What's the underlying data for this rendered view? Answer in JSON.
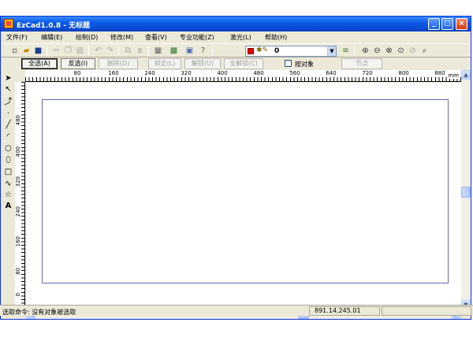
{
  "window": {
    "title": "EzCad1.0.8 - 无标题",
    "controls": {
      "minimize": "_",
      "maximize": "□",
      "close": "×"
    }
  },
  "menubar": {
    "items": [
      "文件(F)",
      "编辑(E)",
      "绘制(D)",
      "修改(M)",
      "查看(V)",
      "专业功能(Z)",
      "激光(L)",
      "帮助(H)"
    ]
  },
  "toolbar": {
    "icons": [
      "new-icon",
      "open-icon",
      "save-icon",
      "cut-icon",
      "copy-icon",
      "paste-icon",
      "undo-icon",
      "redo-icon",
      "group-icon",
      "ungroup-icon",
      "grid-icon",
      "bitmap-icon",
      "export-icon",
      "help-icon",
      "zoom-in-icon",
      "zoom-out-icon",
      "zoom-fit-icon",
      "zoom-all-icon",
      "zoom-prev-icon",
      "zoom-window-icon"
    ],
    "layer_value": "0",
    "layer_color": "#e00000"
  },
  "selectbar": {
    "select_all": "全选(A)",
    "invert": "反选(I)",
    "delete": "删除(D)",
    "lock": "锁定(L)",
    "unlock": "解锁(U)",
    "unlock_all": "全解锁(C)",
    "by_object": "按对象",
    "nodes": "节点"
  },
  "ruler": {
    "h_labels": [
      "80",
      "160",
      "240",
      "320",
      "400",
      "480",
      "560",
      "640",
      "720",
      "800",
      "880"
    ],
    "unit": "mm",
    "v_labels": [
      "480",
      "400",
      "320",
      "240",
      "160",
      "80",
      "0"
    ]
  },
  "statusbar": {
    "message": "选取命令: 没有对象被选取",
    "coords": "891.14,245.01"
  }
}
